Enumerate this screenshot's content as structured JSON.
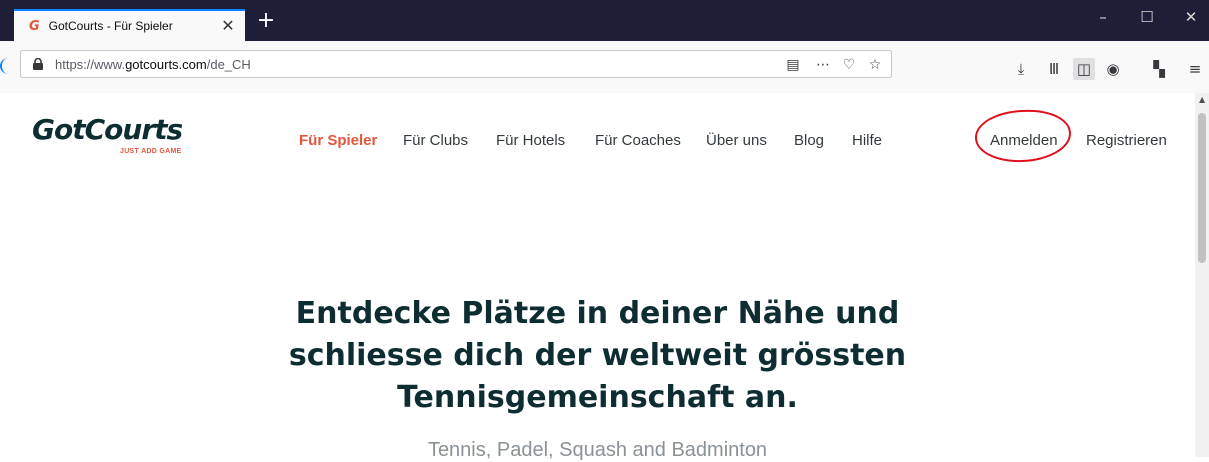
{
  "browser": {
    "tab_title": "GotCourts - Für Spieler",
    "tab_favicon": "G",
    "tab_close": "✕",
    "new_tab": "+",
    "window_controls": {
      "minimize": "–",
      "maximize": "☐",
      "close": "✕"
    },
    "url_prefix": "https://www.",
    "url_domain": "gotcourts.com",
    "url_suffix": "/de_CH",
    "icons": [
      "lock-icon",
      "reader-view-icon",
      "more-actions-icon",
      "pocket-icon",
      "bookmark-star-icon",
      "download-icon",
      "library-icon",
      "sidebar-icon",
      "account-icon",
      "extensions-icon",
      "menu-icon"
    ],
    "accent": "#0a84ff"
  },
  "site": {
    "logo": "GotCourts",
    "logo_tagline": "JUST ADD GAME",
    "nav": {
      "players": "Für Spieler",
      "clubs": "Für Clubs",
      "hotels": "Für Hotels",
      "coaches": "Für Coaches",
      "about": "Über uns",
      "blog": "Blog",
      "help": "Hilfe",
      "login": "Anmelden",
      "register": "Registrieren"
    },
    "hero": {
      "line1": "Entdecke Plätze in deiner Nähe und",
      "line2": "schliesse dich der weltweit grössten",
      "line3": "Tennisgemeinschaft an."
    },
    "subtitle": "Tennis, Padel, Squash and Badminton",
    "colors": {
      "brand_orange": "#e4573d",
      "brand_dark": "#0e2d30",
      "annotation_red": "#e00f1c"
    }
  }
}
